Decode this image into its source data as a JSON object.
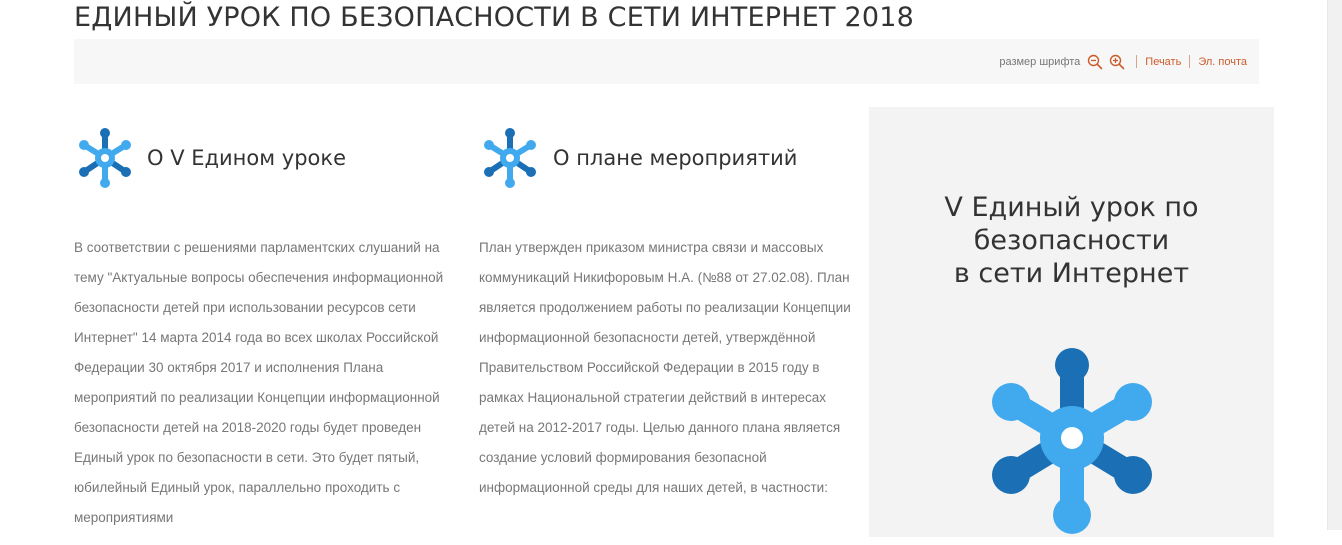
{
  "header": {
    "title": "ЕДИНЫЙ УРОК ПО БЕЗОПАСНОСТИ В СЕТИ ИНТЕРНЕТ 2018"
  },
  "toolbar": {
    "font_size_label": "размер шрифта",
    "zoom_out_icon": "zoom-out-icon",
    "zoom_in_icon": "zoom-in-icon",
    "print_label": "Печать",
    "email_label": "Эл. почта"
  },
  "columns": [
    {
      "icon": "snowflake-icon",
      "title": "О V Едином уроке",
      "text": "В соответствии с решениями парламентских слушаний на тему \"Актуальные вопросы обеспечения информационной безопасности детей при использовании ресурсов сети Интернет\" 14 марта 2014 года во всех школах Российской Федерации 30 октября 2017 и исполнения Плана мероприятий по реализации Концепции информационной безопасности детей на 2018-2020 годы будет проведен Единый урок по безопасности в сети. Это будет пятый, юбилейный Единый урок, параллельно проходить с мероприятиями"
    },
    {
      "icon": "snowflake-icon",
      "title": "О плане мероприятий",
      "text": "План утвержден приказом министра связи и массовых коммуникаций Никифоровым Н.А. (№88 от 27.02.08). План является продолжением работы по реализации Концепции информационной безопасности детей, утверждённой Правительством Российской Федерации в 2015 году в рамках Национальной стратегии действий в интересах детей на 2012-2017 годы. Целью данного плана является создание условий формирования безопасной информационной среды для наших детей, в частности:"
    }
  ],
  "side_panel": {
    "title_line1": "V Единый урок по",
    "title_line2": "безопасности",
    "title_line3": "в сети Интернет",
    "icon": "snowflake-logo-icon"
  },
  "colors": {
    "accent": "#cc5b2a",
    "icon_dark_blue": "#1a6fb5",
    "icon_light_blue": "#41a9ee",
    "panel_bg": "#f3f3f3",
    "toolbar_bg": "#f7f7f7"
  }
}
